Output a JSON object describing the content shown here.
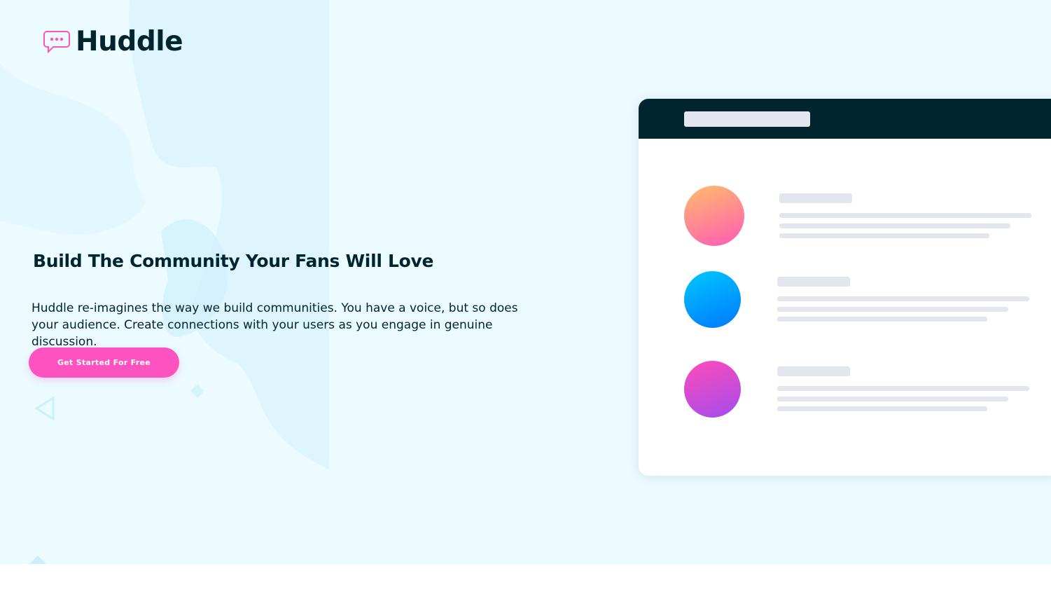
{
  "brand": {
    "name": "Huddle",
    "icon": "speech-bubble-icon",
    "accent": "#ff52c1"
  },
  "hero": {
    "headline": "Build The Community Your Fans Will Love",
    "description": "Huddle re-imagines the way we build communities. You have a voice, but so does your audience. Create connections with your users as you engage in genuine discussion.",
    "cta_label": "Get Started For Free"
  },
  "colors": {
    "dark": "#00252e",
    "hero_bg": "#ebfbff",
    "pink": "#ff52c1"
  },
  "mockup": {
    "avatars": [
      {
        "name": "avatar-orange-pink",
        "from": "#ffbd6b",
        "to": "#ff5ab5"
      },
      {
        "name": "avatar-blue",
        "from": "#00c8ff",
        "to": "#0078ff"
      },
      {
        "name": "avatar-pink-purple",
        "from": "#ff4bb8",
        "to": "#a34cf0"
      }
    ]
  }
}
